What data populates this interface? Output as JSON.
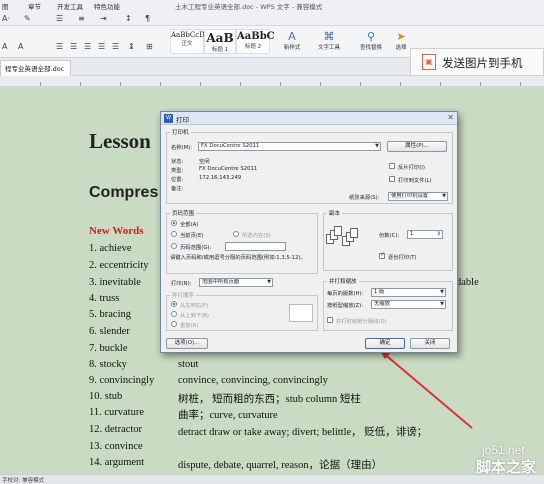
{
  "app": {
    "window_title": "土木工程专业英语全部.doc - WPS 文字 - 兼容模式",
    "doc_tab": "程专业英语全部.doc",
    "menus": [
      "图",
      "章节",
      "开发工具",
      "特色功能"
    ],
    "status_text": "字校对: 兼容模式"
  },
  "ribbon": {
    "styles": [
      {
        "sample": "AaBbCcD",
        "label": "正文"
      },
      {
        "sample": "AaB",
        "label": "标题 1"
      },
      {
        "sample": "AaBbC",
        "label": "标题 2"
      }
    ],
    "new_style": "新样式",
    "text_tools": "文字工具",
    "find_replace": "查找替换",
    "select": "选择",
    "send_to_phone": "发送图片到手机"
  },
  "document": {
    "lesson_title": "Lesson",
    "section_title": "Compres",
    "new_words_label": "New Words",
    "words": [
      {
        "term": "1. achieve",
        "def": ""
      },
      {
        "term": "2. eccentricity",
        "def": ""
      },
      {
        "term": "3. inevitable",
        "def": "dable"
      },
      {
        "term": "4. truss",
        "def": ""
      },
      {
        "term": "5. bracing",
        "def": ""
      },
      {
        "term": "6. slender",
        "def": ""
      },
      {
        "term": "7. buckle",
        "def": ""
      },
      {
        "term": "8. stocky",
        "def": "stout"
      },
      {
        "term": "9. convincingly",
        "def": "convince, convincing, convincingly"
      },
      {
        "term": "10. stub",
        "def": "树桩，  短而粗的东西；stub column  短柱"
      },
      {
        "term": "11. curvature",
        "def": "曲率；curve, curvature"
      },
      {
        "term": "12. detractor",
        "def": "detract    draw or take away; divert; belittle，  贬低，诽谤；"
      },
      {
        "term": "13. convince",
        "def": ""
      },
      {
        "term": "14. argument",
        "def": "dispute, debate, quarrel, reason，论据（理由）"
      }
    ]
  },
  "watermark": {
    "site": "jb51.net",
    "name": "脚本之家"
  },
  "dialog": {
    "title": "打印",
    "printer_group": "打印机",
    "name_label": "名称(M):",
    "printer_name": "FX DocuCentre S2011",
    "properties_button": "属性(P)...",
    "status_label": "状态:",
    "status_value": "空闲",
    "type_label": "类型:",
    "type_value": "FX DocuCentre S2011",
    "location_label": "位置:",
    "location_value": "172.16.143.249",
    "comment_label": "备注:",
    "reverse_print": "反片打印(I)",
    "print_to_file": "打印到文件(L)",
    "paper_source_label": "纸张来源(S):",
    "paper_source_value": "使用打印机设置",
    "page_range_group": "页码范围",
    "all_label": "全部(A)",
    "current_page_label": "当前页(E)",
    "selection_label": "所选内容(S)",
    "pages_label": "页码范围(G):",
    "pages_hint": "请键入页码和/或用逗号分隔的页码范围(例如:1,3,5-12)。",
    "print_label": "打印(N):",
    "print_value": "范围中所有页面",
    "print_order_group": "并打顺序",
    "order_lr": "从左到右(F)",
    "order_tb": "从上到下(B)",
    "order_repeat": "重复(R)",
    "copies_group": "副本",
    "copies_label": "份数(C):",
    "copies_value": "1",
    "collate_label": "逐份打印(T)",
    "zoom_group": "并打和缩放",
    "pages_per_sheet_label": "每页的版数(H):",
    "pages_per_sheet_value": "1 版",
    "scale_label": "按纸型缩放(Z):",
    "scale_value": "无缩放",
    "draw_border": "并打时绘制分隔线(D)",
    "options_button": "选项(O)...",
    "ok_button": "确定",
    "cancel_button": "关闭"
  },
  "colors": {
    "new_words": "#d02020",
    "doc_bg": "#c9dcc3",
    "annotation_arrow": "#e03030"
  }
}
